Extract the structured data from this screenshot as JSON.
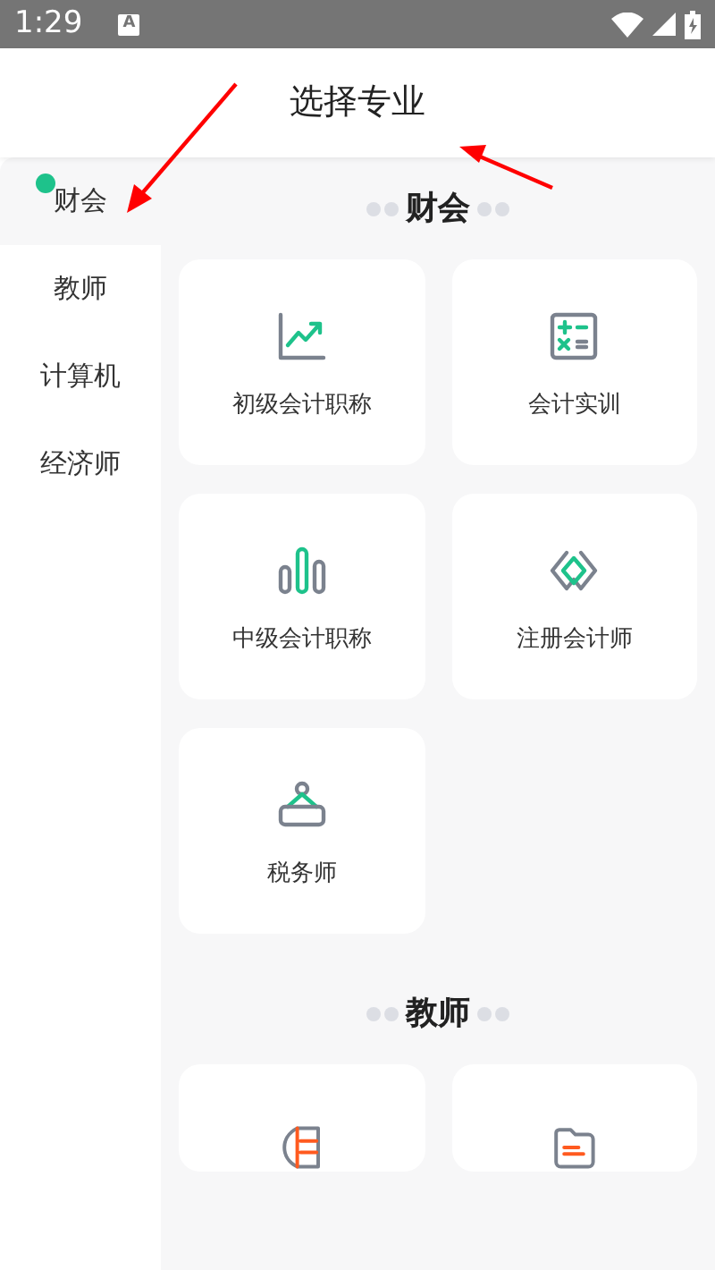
{
  "status_bar": {
    "time": "1:29",
    "notification": "A"
  },
  "header": {
    "title": "选择专业"
  },
  "sidebar": {
    "items": [
      {
        "label": "财会",
        "selected": true
      },
      {
        "label": "教师",
        "selected": false
      },
      {
        "label": "计算机",
        "selected": false
      },
      {
        "label": "经济师",
        "selected": false
      }
    ]
  },
  "sections": [
    {
      "title": "财会",
      "items": [
        {
          "label": "初级会计职称",
          "cut": false
        },
        {
          "label": "会计实训",
          "cut": false
        },
        {
          "label": "中级会计职称",
          "cut": false
        },
        {
          "label": "注册会计师",
          "cut": false
        },
        {
          "label": "税务师",
          "cut": false
        }
      ]
    },
    {
      "title": "教师",
      "items": [
        {
          "cut": true
        },
        {
          "cut": true
        }
      ]
    }
  ]
}
